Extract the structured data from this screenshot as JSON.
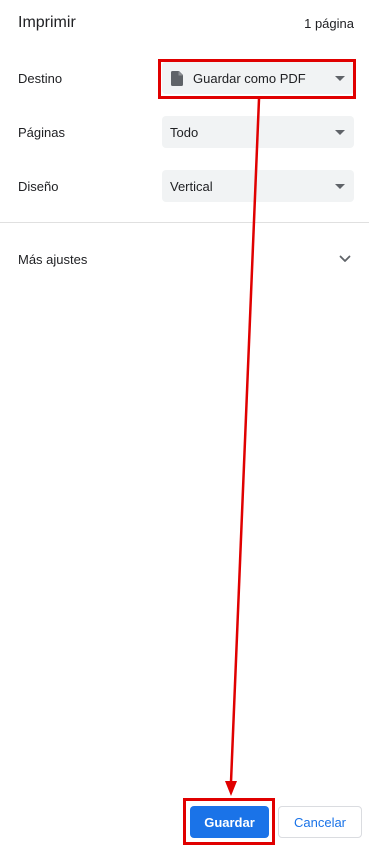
{
  "header": {
    "title": "Imprimir",
    "page_count": "1 página"
  },
  "destination": {
    "label": "Destino",
    "value": "Guardar como PDF",
    "icon": "document-icon"
  },
  "pages": {
    "label": "Páginas",
    "value": "Todo"
  },
  "layout": {
    "label": "Diseño",
    "value": "Vertical"
  },
  "more_settings": {
    "label": "Más ajustes",
    "icon": "chevron-down-icon"
  },
  "actions": {
    "save_label": "Guardar",
    "cancel_label": "Cancelar"
  },
  "colors": {
    "accent": "#1a73e8",
    "annotation": "#e00000",
    "select_bg": "#f1f3f4"
  }
}
